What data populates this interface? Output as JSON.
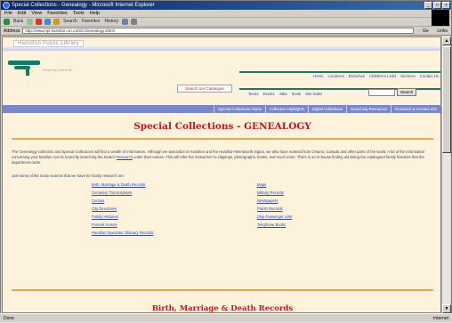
{
  "window": {
    "title": "Special Collections - Genealogy - Microsoft Internet Explorer"
  },
  "menu": [
    "File",
    "Edit",
    "View",
    "Favorites",
    "Tools",
    "Help"
  ],
  "toolbar": [
    "Back",
    "Forward",
    "Stop",
    "Refresh",
    "Home",
    "Search",
    "Favorites",
    "History",
    "Mail",
    "Print"
  ],
  "address": {
    "label": "Address",
    "url": "http://www.hpl.hamilton.on.ca/SC/Genealogy.shtml",
    "go": "Go",
    "links": "Links"
  },
  "library": {
    "name": "Hamilton Public Library",
    "tagline": "Reading Connects",
    "catalogue_button": "Search our Catalogue",
    "nav_top": [
      "Home",
      "Locations",
      "Branches",
      "Children's Links",
      "Services",
      "Contact Us"
    ],
    "nav_bottom": [
      "Teens",
      "Events",
      "Jobs",
      "Kiosk",
      "Site Index"
    ],
    "search_button": "Search",
    "bluebar": [
      "Special Collections Home",
      "Collection Highlights",
      "Digital Collections",
      "Searching Resources",
      "Research & Contact Info"
    ]
  },
  "page": {
    "title": "Special Collections - GENEALOGY",
    "intro": "The Genealogy collection and Special Collections will find a wealth of information. Although we specialize in Hamilton and the Hamilton-Wentworth region, we also have material from Ontario, Canada and other parts of the world. A lot of the information concerning your families can be found by searching the Search",
    "intro_link": "Research",
    "intro_tail": "under their names. This will refer the researcher to clippings, photographs, books, and much more. There is an in-house finding aid listing the catalogued family histories that the department owns.",
    "lead": "Just some of the many sources that we have for family research are:",
    "sources_left": [
      "Birth, Marriage & Death Records",
      "Cemetery Transcriptions",
      "Census",
      "City Directories",
      "Family Histories",
      "Funeral Homes",
      "Hamilton Spectator Obituary Records"
    ],
    "sources_right": [
      "Maps",
      "Military Records",
      "Newspapers",
      "Parish Records",
      "Ship Passenger Lists",
      "Telephone Books"
    ],
    "section_title": "Birth, Marriage & Death Records"
  },
  "status": {
    "text": "Done",
    "zone": "Internet"
  }
}
